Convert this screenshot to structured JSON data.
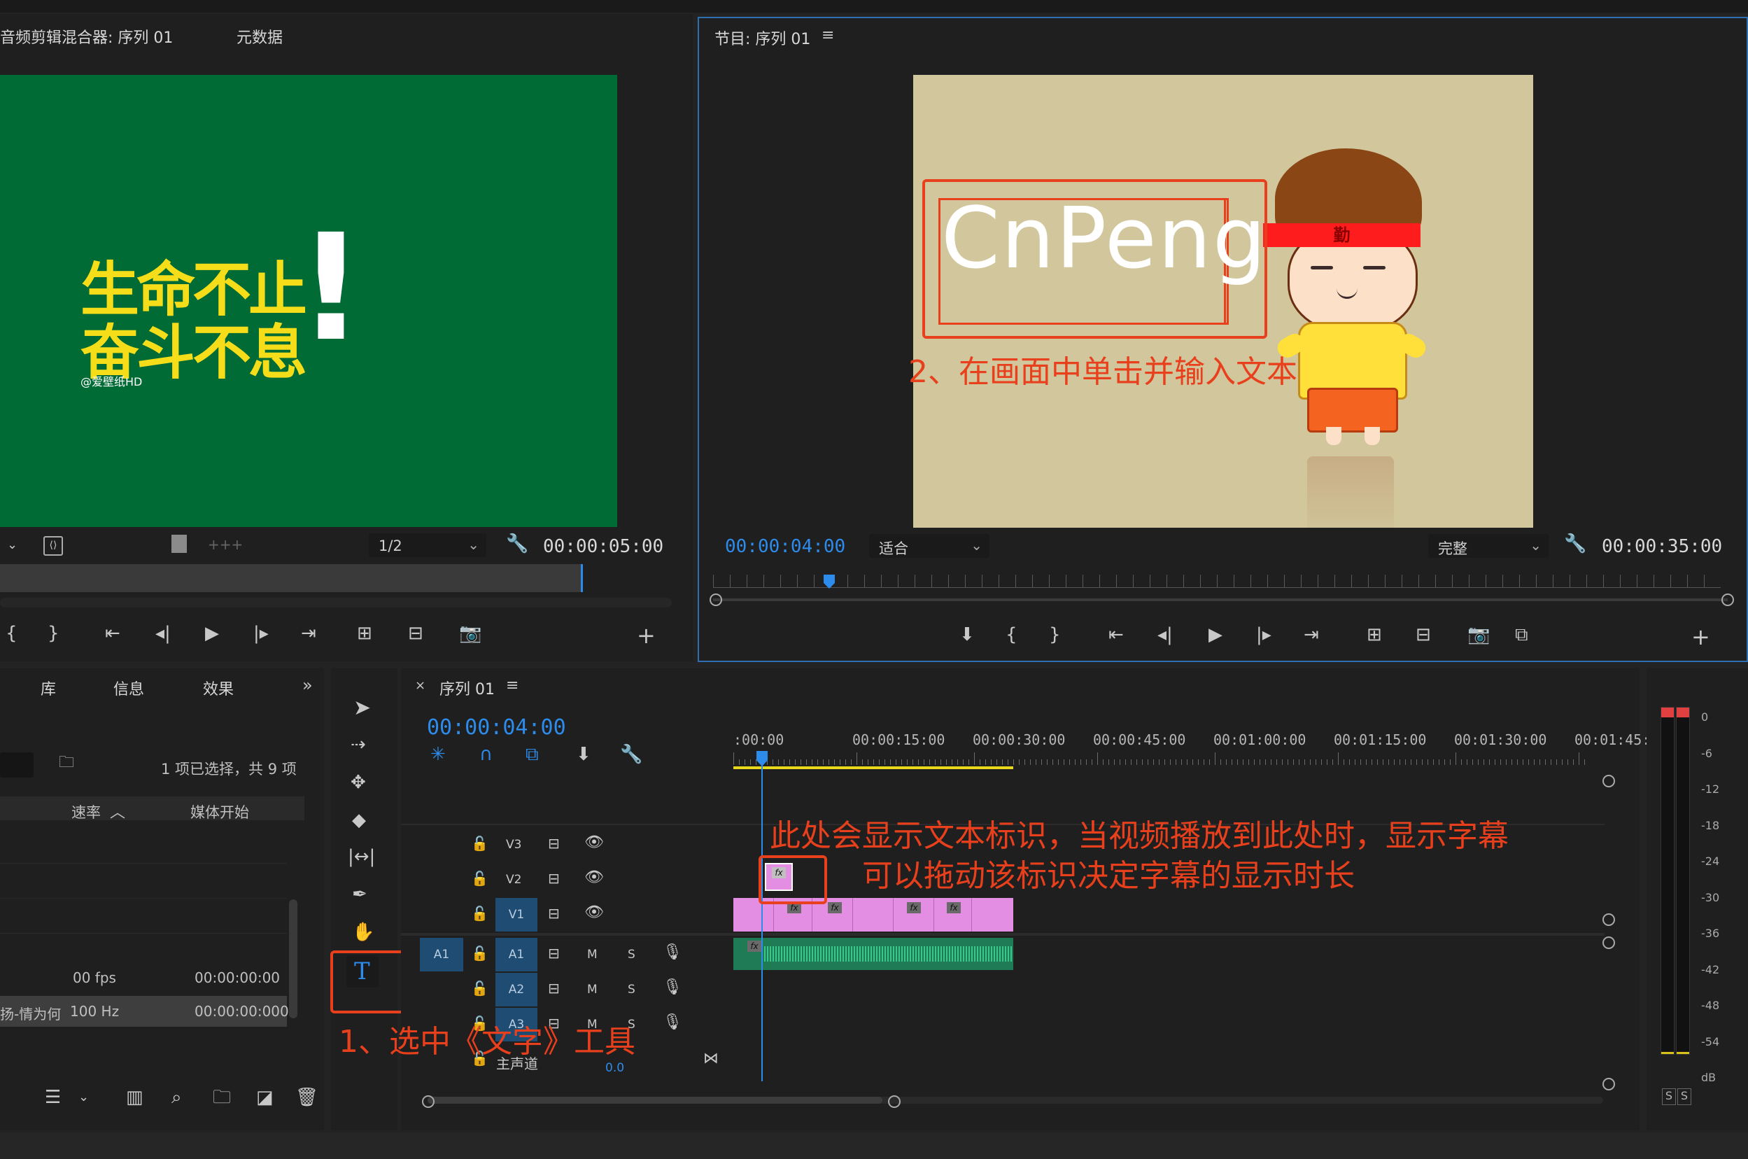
{
  "source_panel": {
    "tab_mixer": "音频剪辑混合器: 序列 01",
    "tab_metadata": "元数据",
    "poster_line1": "生命不止",
    "poster_line2": "奋斗不息",
    "poster_mark": "!",
    "poster_credit": "@爱壁纸HD",
    "resolution": "1/2",
    "duration": "00:00:05:00"
  },
  "program_panel": {
    "title": "节目: 序列 01",
    "overlay_text": "CnPeng",
    "timecode": "00:00:04:00",
    "zoom": "适合",
    "quality": "完整",
    "duration": "00:00:35:00",
    "character_headband": "勤"
  },
  "project_panel": {
    "tab_library": "库",
    "tab_info": "信息",
    "tab_effects": "效果",
    "selection": "1 项已选择，共 9 项",
    "col_rate": "速率",
    "col_media_start": "媒体开始",
    "row1_rate": "00 fps",
    "row1_start": "00:00:00:00",
    "row2_name": "扬-情为何",
    "row2_rate": "100 Hz",
    "row2_start": "00:00:00:000"
  },
  "timeline": {
    "title": "序列 01",
    "timecode": "00:00:04:00",
    "ruler": [
      ":00:00",
      "00:00:15:00",
      "00:00:30:00",
      "00:00:45:00",
      "00:01:00:00",
      "00:01:15:00",
      "00:01:30:00",
      "00:01:45:"
    ],
    "tracks_video": [
      "V3",
      "V2",
      "V1"
    ],
    "tracks_audio": [
      "A1",
      "A2",
      "A3"
    ],
    "source_patch": "A1",
    "master_label": "主声道",
    "master_value": "0.0",
    "m_label": "M",
    "s_label": "S",
    "fx_label": "fx"
  },
  "meter": {
    "scale": [
      "0",
      "-6",
      "-12",
      "-18",
      "-24",
      "-30",
      "-36",
      "-42",
      "-48",
      "-54",
      "dB"
    ],
    "solo": "S"
  },
  "annotations": {
    "step1": "1、选中《文字》工具",
    "step2": "2、在画面中单击并输入文本",
    "note_line1": "此处会显示文本标识，当视频播放到此处时，显示字幕",
    "note_line2": "可以拖动该标识决定字幕的显示时长"
  },
  "colors": {
    "accent_blue": "#2d8ceb",
    "annotation_red": "#e8401c",
    "poster_green": "#006b35",
    "poster_yellow": "#f5dd1a",
    "program_bg": "#d1c69c",
    "clip_pink": "#e48ee3",
    "audio_green": "#1fa56c"
  }
}
